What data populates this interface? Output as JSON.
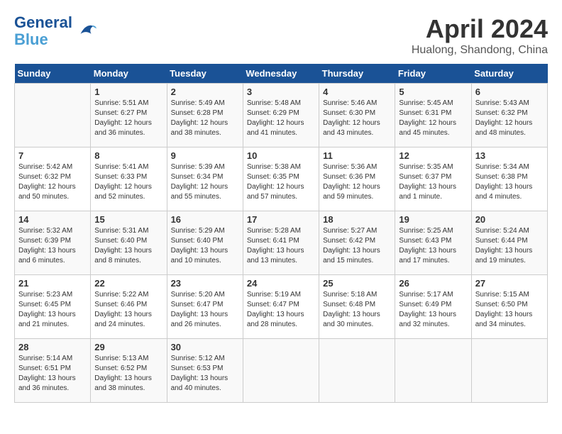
{
  "header": {
    "logo_line1": "General",
    "logo_line2": "Blue",
    "title": "April 2024",
    "subtitle": "Hualong, Shandong, China"
  },
  "days_of_week": [
    "Sunday",
    "Monday",
    "Tuesday",
    "Wednesday",
    "Thursday",
    "Friday",
    "Saturday"
  ],
  "weeks": [
    [
      {
        "day": "",
        "info": ""
      },
      {
        "day": "1",
        "info": "Sunrise: 5:51 AM\nSunset: 6:27 PM\nDaylight: 12 hours\nand 36 minutes."
      },
      {
        "day": "2",
        "info": "Sunrise: 5:49 AM\nSunset: 6:28 PM\nDaylight: 12 hours\nand 38 minutes."
      },
      {
        "day": "3",
        "info": "Sunrise: 5:48 AM\nSunset: 6:29 PM\nDaylight: 12 hours\nand 41 minutes."
      },
      {
        "day": "4",
        "info": "Sunrise: 5:46 AM\nSunset: 6:30 PM\nDaylight: 12 hours\nand 43 minutes."
      },
      {
        "day": "5",
        "info": "Sunrise: 5:45 AM\nSunset: 6:31 PM\nDaylight: 12 hours\nand 45 minutes."
      },
      {
        "day": "6",
        "info": "Sunrise: 5:43 AM\nSunset: 6:32 PM\nDaylight: 12 hours\nand 48 minutes."
      }
    ],
    [
      {
        "day": "7",
        "info": "Sunrise: 5:42 AM\nSunset: 6:32 PM\nDaylight: 12 hours\nand 50 minutes."
      },
      {
        "day": "8",
        "info": "Sunrise: 5:41 AM\nSunset: 6:33 PM\nDaylight: 12 hours\nand 52 minutes."
      },
      {
        "day": "9",
        "info": "Sunrise: 5:39 AM\nSunset: 6:34 PM\nDaylight: 12 hours\nand 55 minutes."
      },
      {
        "day": "10",
        "info": "Sunrise: 5:38 AM\nSunset: 6:35 PM\nDaylight: 12 hours\nand 57 minutes."
      },
      {
        "day": "11",
        "info": "Sunrise: 5:36 AM\nSunset: 6:36 PM\nDaylight: 12 hours\nand 59 minutes."
      },
      {
        "day": "12",
        "info": "Sunrise: 5:35 AM\nSunset: 6:37 PM\nDaylight: 13 hours\nand 1 minute."
      },
      {
        "day": "13",
        "info": "Sunrise: 5:34 AM\nSunset: 6:38 PM\nDaylight: 13 hours\nand 4 minutes."
      }
    ],
    [
      {
        "day": "14",
        "info": "Sunrise: 5:32 AM\nSunset: 6:39 PM\nDaylight: 13 hours\nand 6 minutes."
      },
      {
        "day": "15",
        "info": "Sunrise: 5:31 AM\nSunset: 6:40 PM\nDaylight: 13 hours\nand 8 minutes."
      },
      {
        "day": "16",
        "info": "Sunrise: 5:29 AM\nSunset: 6:40 PM\nDaylight: 13 hours\nand 10 minutes."
      },
      {
        "day": "17",
        "info": "Sunrise: 5:28 AM\nSunset: 6:41 PM\nDaylight: 13 hours\nand 13 minutes."
      },
      {
        "day": "18",
        "info": "Sunrise: 5:27 AM\nSunset: 6:42 PM\nDaylight: 13 hours\nand 15 minutes."
      },
      {
        "day": "19",
        "info": "Sunrise: 5:25 AM\nSunset: 6:43 PM\nDaylight: 13 hours\nand 17 minutes."
      },
      {
        "day": "20",
        "info": "Sunrise: 5:24 AM\nSunset: 6:44 PM\nDaylight: 13 hours\nand 19 minutes."
      }
    ],
    [
      {
        "day": "21",
        "info": "Sunrise: 5:23 AM\nSunset: 6:45 PM\nDaylight: 13 hours\nand 21 minutes."
      },
      {
        "day": "22",
        "info": "Sunrise: 5:22 AM\nSunset: 6:46 PM\nDaylight: 13 hours\nand 24 minutes."
      },
      {
        "day": "23",
        "info": "Sunrise: 5:20 AM\nSunset: 6:47 PM\nDaylight: 13 hours\nand 26 minutes."
      },
      {
        "day": "24",
        "info": "Sunrise: 5:19 AM\nSunset: 6:47 PM\nDaylight: 13 hours\nand 28 minutes."
      },
      {
        "day": "25",
        "info": "Sunrise: 5:18 AM\nSunset: 6:48 PM\nDaylight: 13 hours\nand 30 minutes."
      },
      {
        "day": "26",
        "info": "Sunrise: 5:17 AM\nSunset: 6:49 PM\nDaylight: 13 hours\nand 32 minutes."
      },
      {
        "day": "27",
        "info": "Sunrise: 5:15 AM\nSunset: 6:50 PM\nDaylight: 13 hours\nand 34 minutes."
      }
    ],
    [
      {
        "day": "28",
        "info": "Sunrise: 5:14 AM\nSunset: 6:51 PM\nDaylight: 13 hours\nand 36 minutes."
      },
      {
        "day": "29",
        "info": "Sunrise: 5:13 AM\nSunset: 6:52 PM\nDaylight: 13 hours\nand 38 minutes."
      },
      {
        "day": "30",
        "info": "Sunrise: 5:12 AM\nSunset: 6:53 PM\nDaylight: 13 hours\nand 40 minutes."
      },
      {
        "day": "",
        "info": ""
      },
      {
        "day": "",
        "info": ""
      },
      {
        "day": "",
        "info": ""
      },
      {
        "day": "",
        "info": ""
      }
    ]
  ]
}
